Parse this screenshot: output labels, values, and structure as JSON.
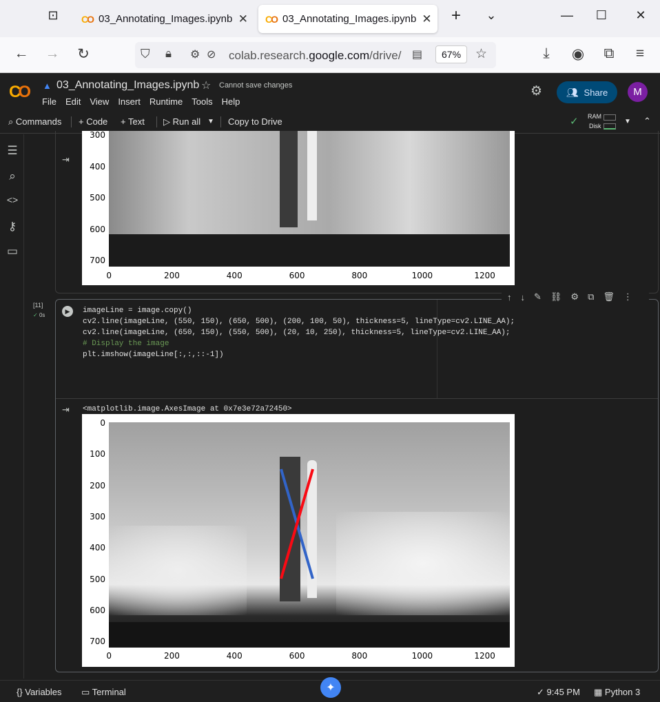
{
  "browser": {
    "tabs": [
      {
        "title": "03_Annotating_Images.ipynb",
        "active": false
      },
      {
        "title": "03_Annotating_Images.ipynb",
        "active": true
      }
    ],
    "url_host": "colab.research.",
    "url_domain": "google.com",
    "url_path": "/drive/",
    "zoom": "67%"
  },
  "colab": {
    "notebook_title": "03_Annotating_Images.ipynb",
    "cannot_save": "Cannot save changes",
    "menu": [
      "File",
      "Edit",
      "View",
      "Insert",
      "Runtime",
      "Tools",
      "Help"
    ],
    "share_label": "Share",
    "avatar_initial": "M"
  },
  "toolbar": {
    "commands": "Commands",
    "code": "+ Code",
    "text": "+ Text",
    "run_all": "Run all",
    "copy_to_drive": "Copy to Drive",
    "ram": "RAM",
    "disk": "Disk"
  },
  "cell_top": {
    "y_ticks": [
      "300",
      "400",
      "500",
      "600",
      "700"
    ],
    "x_ticks": [
      "0",
      "200",
      "400",
      "600",
      "800",
      "1000",
      "1200"
    ]
  },
  "cell_11": {
    "exec_count": "[11]",
    "exec_time": "0s",
    "code_lines": [
      "imageLine = image.copy()",
      "",
      "cv2.line(imageLine, (550, 150), (650, 500), (200, 100, 50), thickness=5, lineType=cv2.LINE_AA);",
      "cv2.line(imageLine, (650, 150), (550, 500), (20, 10, 250), thickness=5, lineType=cv2.LINE_AA);",
      "",
      "",
      "# Display the image",
      "plt.imshow(imageLine[:,:,::-1])"
    ],
    "output_text": "<matplotlib.image.AxesImage at 0x7e3e72a72450>",
    "y_ticks": [
      "0",
      "100",
      "200",
      "300",
      "400",
      "500",
      "600",
      "700"
    ],
    "x_ticks": [
      "0",
      "200",
      "400",
      "600",
      "800",
      "1000",
      "1200"
    ]
  },
  "status": {
    "variables": "Variables",
    "terminal": "Terminal",
    "time": "9:45 PM",
    "runtime": "Python 3"
  },
  "colors": {
    "blue_line": "#3264c8",
    "red_line": "#fa0a14",
    "share_bg": "#004a77",
    "avatar_bg": "#7b1fa2"
  }
}
